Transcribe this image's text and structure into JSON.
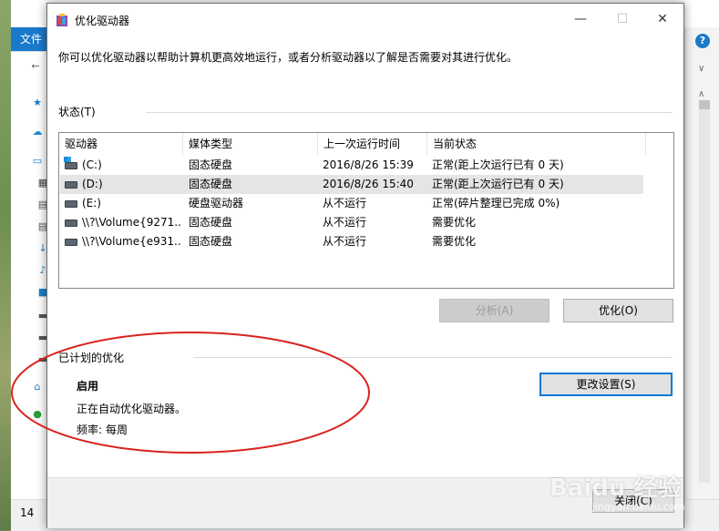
{
  "explorer": {
    "file_tab": "文件",
    "status_count": "14",
    "help": "?"
  },
  "dialog": {
    "title": "优化驱动器",
    "minimize": "—",
    "maximize": "☐",
    "close": "✕",
    "intro": "你可以优化驱动器以帮助计算机更高效地运行，或者分析驱动器以了解是否需要对其进行优化。",
    "status_label": "状态(T)",
    "columns": [
      "驱动器",
      "媒体类型",
      "上一次运行时间",
      "当前状态"
    ],
    "drives": [
      {
        "name": "(C:)",
        "media": "固态硬盘",
        "last_run": "2016/8/26 15:39",
        "status": "正常(距上次运行已有 0 天)",
        "icon": "system-drive-icon"
      },
      {
        "name": "(D:)",
        "media": "固态硬盘",
        "last_run": "2016/8/26 15:40",
        "status": "正常(距上次运行已有 0 天)",
        "icon": "drive-icon"
      },
      {
        "name": "(E:)",
        "media": "硬盘驱动器",
        "last_run": "从不运行",
        "status": "正常(碎片整理已完成 0%)",
        "icon": "drive-icon"
      },
      {
        "name": "\\\\?\\Volume{9271...",
        "media": "固态硬盘",
        "last_run": "从不运行",
        "status": "需要优化",
        "icon": "drive-icon"
      },
      {
        "name": "\\\\?\\Volume{e931...",
        "media": "固态硬盘",
        "last_run": "从不运行",
        "status": "需要优化",
        "icon": "drive-icon"
      }
    ],
    "analyze_button": "分析(A)",
    "optimize_button": "优化(O)",
    "scheduled_label": "已计划的优化",
    "scheduled_state": "启用",
    "scheduled_desc": "正在自动优化驱动器。",
    "frequency_label": "频率:",
    "frequency_value": "每周",
    "change_settings_button": "更改设置(S)",
    "close_button": "关闭(C)"
  },
  "annotation_color": "#d9231f",
  "watermark": {
    "main": "Baidu 经验",
    "sub": "jingyan.baidu.com"
  }
}
